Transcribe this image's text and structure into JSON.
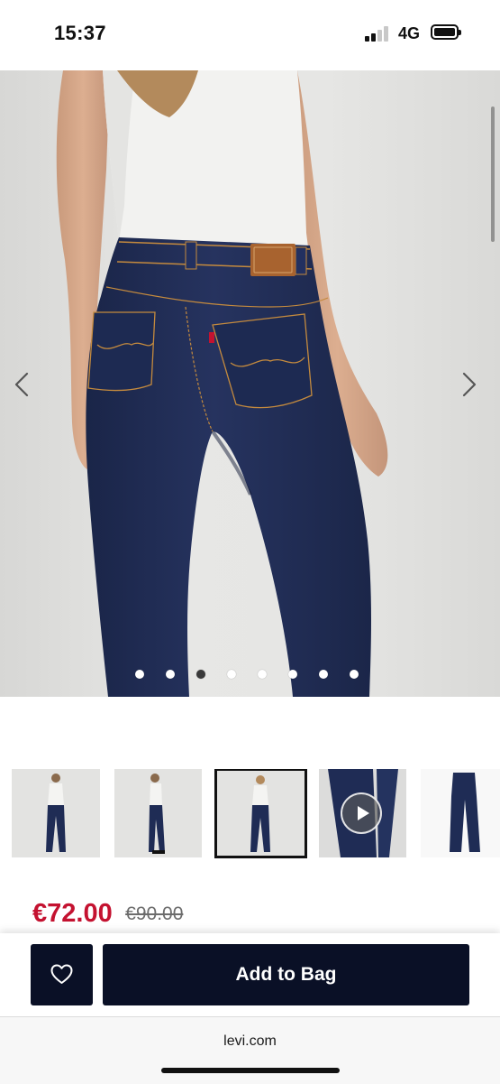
{
  "status_bar": {
    "time": "15:37",
    "network": "4G"
  },
  "gallery": {
    "total_images": 8,
    "active_index": 2
  },
  "thumbnails": [
    {
      "name": "front-view"
    },
    {
      "name": "side-view"
    },
    {
      "name": "back-view",
      "selected": true
    },
    {
      "name": "detail-video",
      "video": true
    },
    {
      "name": "flat-lay"
    }
  ],
  "price": {
    "sale": "€72.00",
    "original": "€90.00"
  },
  "actions": {
    "add_to_bag_label": "Add to Bag",
    "wishlist_icon": "heart-icon"
  },
  "browser": {
    "url": "levi.com"
  },
  "colors": {
    "sale_red": "#c41230",
    "button_navy": "#0a1026",
    "denim": "#1f2c55"
  }
}
